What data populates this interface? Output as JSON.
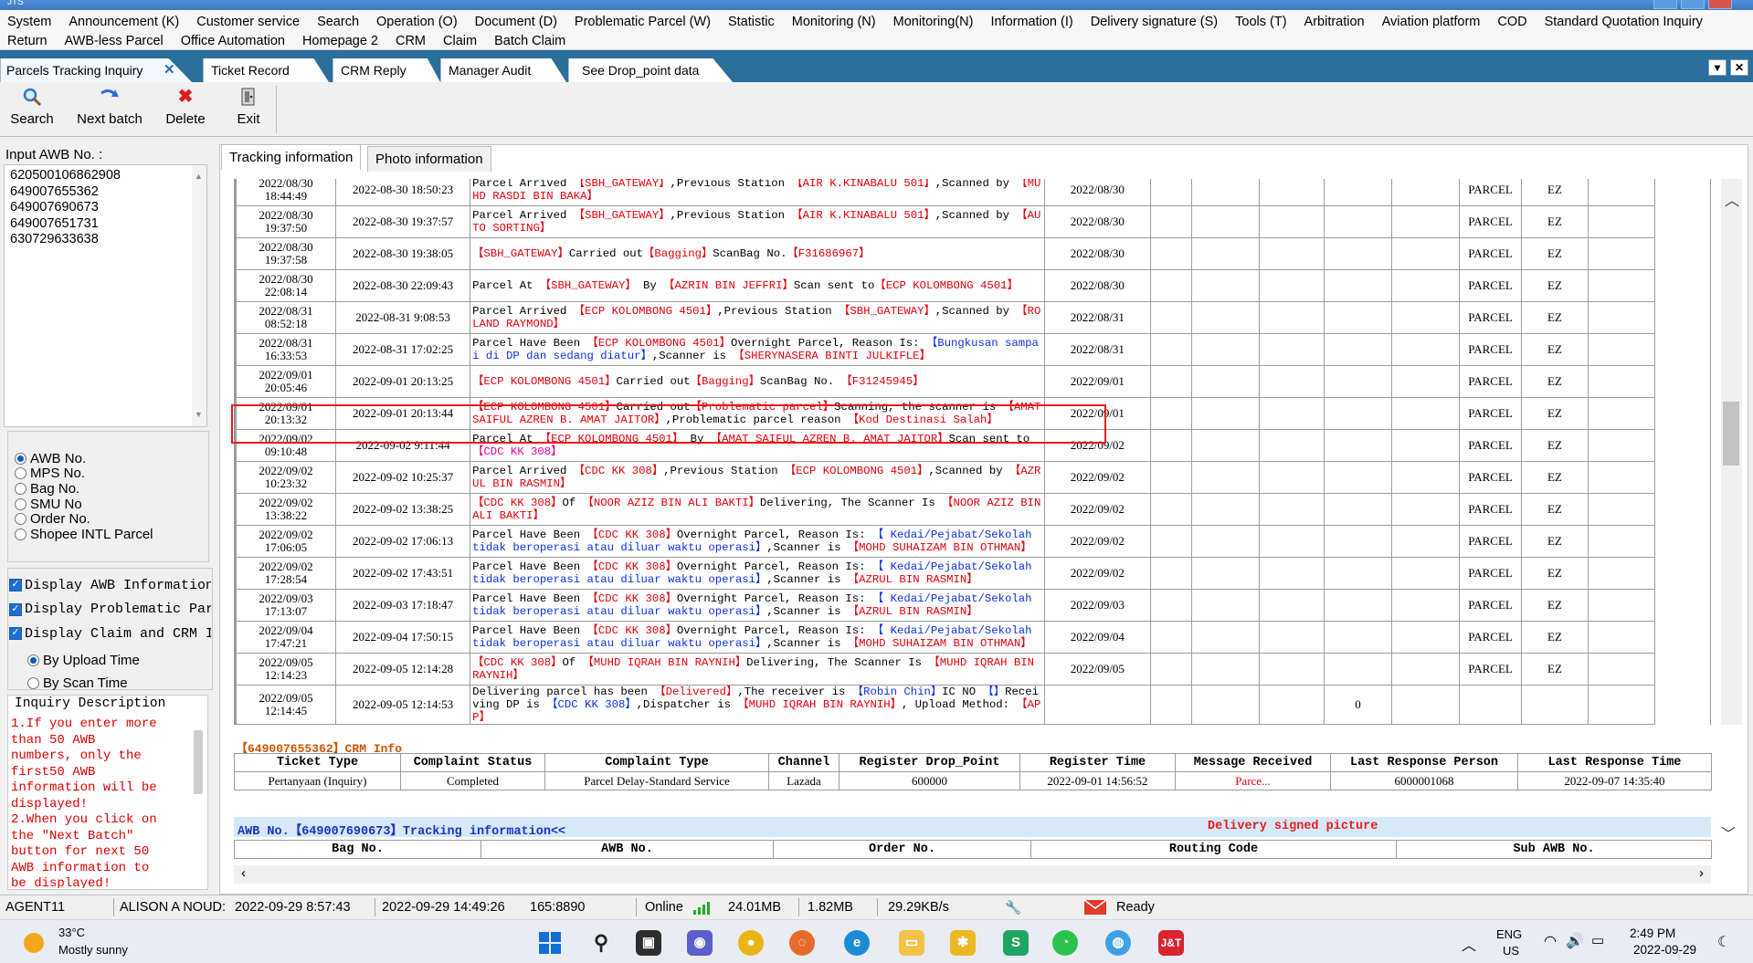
{
  "window": {
    "title": "JTS"
  },
  "menu": {
    "row1": [
      "System",
      "Announcement (K)",
      "Customer service",
      "Search",
      "Operation (O)",
      "Document (D)",
      "Problematic Parcel (W)",
      "Statistic",
      "Monitoring (N)",
      "Monitoring(N)",
      "Information (I)",
      "Delivery signature (S)",
      "Tools (T)",
      "Arbitration",
      "Aviation platform",
      "COD",
      "Standard Quotation Inquiry"
    ],
    "row2": [
      "Return",
      "AWB-less Parcel",
      "Office Automation",
      "Homepage 2",
      "CRM",
      "Claim",
      "Batch Claim"
    ]
  },
  "doc_tabs": [
    "Parcels Tracking Inquiry",
    "Ticket Record",
    "CRM Reply",
    "Manager Audit",
    "See Drop_point data"
  ],
  "toolbar": {
    "search": "Search",
    "next_batch": "Next batch",
    "delete": "Delete",
    "exit": "Exit"
  },
  "left": {
    "input_label": "Input AWB No. :",
    "awbs": [
      "620500106862908",
      "649007655362",
      "649007690673",
      "649007651731",
      "630729633638"
    ],
    "radio_options": [
      "AWB No.",
      "MPS No.",
      "Bag No.",
      "SMU No",
      "Order No.",
      "Shopee INTL Parcel"
    ],
    "checkboxes": [
      "Display AWB Information",
      "Display Problematic Par",
      "Display Claim and CRM I"
    ],
    "time_options": [
      "By Upload Time",
      "By Scan Time"
    ],
    "inquiry_title": "Inquiry Description",
    "inquiry_text": "1.If you enter more than 50 AWB numbers, only the first50 AWB information will be displayed!\n2.When you click on the \"Next Batch\" button for next 50 AWB information to be displayed!"
  },
  "content_tabs": [
    "Tracking information",
    "Photo information"
  ],
  "tracking_rows": [
    {
      "upload": "2022/08/30 18:44:49",
      "scan": "2022-08-30 18:50:23",
      "desc": [
        [
          "k",
          "Parcel Arrived "
        ],
        [
          "r",
          "【SBH_GATEWAY】"
        ],
        [
          "k",
          ",Previous Station "
        ],
        [
          "r",
          "【AIR K.KINABALU 501】"
        ],
        [
          "k",
          ",Scanned by "
        ],
        [
          "r",
          "【MUHD RASDI BIN BAKA】"
        ]
      ],
      "date": "2022/08/30",
      "extra": "",
      "type": "PARCEL",
      "code": "EZ"
    },
    {
      "upload": "2022/08/30 19:37:50",
      "scan": "2022-08-30 19:37:57",
      "desc": [
        [
          "k",
          "Parcel Arrived "
        ],
        [
          "r",
          "【SBH_GATEWAY】"
        ],
        [
          "k",
          ",Previous Station "
        ],
        [
          "r",
          "【AIR K.KINABALU 501】"
        ],
        [
          "k",
          ",Scanned by "
        ],
        [
          "r",
          "【AUTO SORTING】"
        ]
      ],
      "date": "2022/08/30",
      "extra": "",
      "type": "PARCEL",
      "code": "EZ"
    },
    {
      "upload": "2022/08/30 19:37:58",
      "scan": "2022-08-30 19:38:05",
      "desc": [
        [
          "r",
          "【SBH_GATEWAY】"
        ],
        [
          "k",
          "Carried out"
        ],
        [
          "r",
          "【Bagging】"
        ],
        [
          "k",
          "ScanBag No."
        ],
        [
          "r",
          "【F31686967】"
        ]
      ],
      "date": "2022/08/30",
      "extra": "",
      "type": "PARCEL",
      "code": "EZ"
    },
    {
      "upload": "2022/08/30 22:08:14",
      "scan": "2022-08-30 22:09:43",
      "desc": [
        [
          "k",
          "Parcel At "
        ],
        [
          "r",
          "【SBH_GATEWAY】"
        ],
        [
          "k",
          " By "
        ],
        [
          "r",
          "【AZRIN BIN JEFFRI】"
        ],
        [
          "k",
          "Scan sent to"
        ],
        [
          "r",
          "【ECP KOLOMBONG 4501】"
        ]
      ],
      "date": "2022/08/30",
      "extra": "",
      "type": "PARCEL",
      "code": "EZ"
    },
    {
      "upload": "2022/08/31 08:52:18",
      "scan": "2022-08-31 9:08:53",
      "desc": [
        [
          "k",
          "Parcel Arrived "
        ],
        [
          "r",
          "【ECP KOLOMBONG 4501】"
        ],
        [
          "k",
          ",Previous Station "
        ],
        [
          "r",
          "【SBH_GATEWAY】"
        ],
        [
          "k",
          ",Scanned by "
        ],
        [
          "r",
          "【ROLAND RAYMOND】"
        ]
      ],
      "date": "2022/08/31",
      "extra": "",
      "type": "PARCEL",
      "code": "EZ"
    },
    {
      "upload": "2022/08/31 16:33:53",
      "scan": "2022-08-31 17:02:25",
      "desc": [
        [
          "k",
          "Parcel Have Been "
        ],
        [
          "r",
          "【ECP KOLOMBONG 4501】"
        ],
        [
          "k",
          "Overnight Parcel, Reason Is: "
        ],
        [
          "b",
          "【Bungkusan sampai di DP dan sedang diatur】"
        ],
        [
          "k",
          ",Scanner is "
        ],
        [
          "r",
          "【SHERYNASERA BINTI JULKIFLE】"
        ]
      ],
      "date": "2022/08/31",
      "extra": "",
      "type": "PARCEL",
      "code": "EZ"
    },
    {
      "upload": "2022/09/01 20:05:46",
      "scan": "2022-09-01 20:13:25",
      "desc": [
        [
          "r",
          "【ECP KOLOMBONG 4501】"
        ],
        [
          "k",
          "Carried out"
        ],
        [
          "r",
          "【Bagging】"
        ],
        [
          "k",
          "ScanBag No. "
        ],
        [
          "r",
          "【F31245945】"
        ]
      ],
      "date": "2022/09/01",
      "extra": "",
      "type": "PARCEL",
      "code": "EZ"
    },
    {
      "upload": "2022/09/01 20:13:32",
      "scan": "2022-09-01 20:13:44",
      "desc": [
        [
          "r",
          "【ECP KOLOMBONG 4501】"
        ],
        [
          "k",
          "Carried out"
        ],
        [
          "r",
          "【Problematic parcel】"
        ],
        [
          "k",
          "Scanning, the scanner is "
        ],
        [
          "r",
          "【AMAT SAIFUL AZREN B. AMAT JAITOR】"
        ],
        [
          "k",
          ",Problematic parcel reason "
        ],
        [
          "r",
          "【Kod Destinasi Salah】"
        ]
      ],
      "date": "2022/09/01",
      "extra": "",
      "type": "PARCEL",
      "code": "EZ"
    },
    {
      "upload": "2022/09/02 09:10:48",
      "scan": "2022-09-02 9:11:44",
      "desc": [
        [
          "k",
          "Parcel At "
        ],
        [
          "r",
          "【ECP KOLOMBONG 4501】"
        ],
        [
          "k",
          " By "
        ],
        [
          "r",
          "【AMAT SAIFUL AZREN B. AMAT JAITOR】"
        ],
        [
          "k",
          "Scan sent to"
        ],
        [
          "m",
          "【CDC KK 308】"
        ]
      ],
      "date": "2022/09/02",
      "extra": "",
      "type": "PARCEL",
      "code": "EZ"
    },
    {
      "upload": "2022/09/02 10:23:32",
      "scan": "2022-09-02 10:25:37",
      "desc": [
        [
          "k",
          "Parcel Arrived "
        ],
        [
          "r",
          "【CDC KK 308】"
        ],
        [
          "k",
          ",Previous Station "
        ],
        [
          "r",
          "【ECP KOLOMBONG 4501】"
        ],
        [
          "k",
          ",Scanned by "
        ],
        [
          "r",
          "【AZRUL BIN RASMIN】"
        ]
      ],
      "date": "2022/09/02",
      "extra": "",
      "type": "PARCEL",
      "code": "EZ"
    },
    {
      "upload": "2022/09/02 13:38:22",
      "scan": "2022-09-02 13:38:25",
      "desc": [
        [
          "r",
          "【CDC KK 308】"
        ],
        [
          "k",
          "Of "
        ],
        [
          "r",
          "【NOOR AZIZ BIN ALI BAKTI】"
        ],
        [
          "k",
          "Delivering, The Scanner Is "
        ],
        [
          "r",
          "【NOOR AZIZ BIN ALI BAKTI】"
        ]
      ],
      "date": "2022/09/02",
      "extra": "",
      "type": "PARCEL",
      "code": "EZ"
    },
    {
      "upload": "2022/09/02 17:06:05",
      "scan": "2022-09-02 17:06:13",
      "desc": [
        [
          "k",
          "Parcel Have Been "
        ],
        [
          "r",
          "【CDC KK 308】"
        ],
        [
          "k",
          "Overnight Parcel, Reason Is: "
        ],
        [
          "b",
          "【 Kedai/Pejabat/Sekolah tidak beroperasi atau diluar waktu operasi】"
        ],
        [
          "k",
          ",Scanner is "
        ],
        [
          "r",
          "【MOHD SUHAIZAM BIN OTHMAN】"
        ]
      ],
      "date": "2022/09/02",
      "extra": "",
      "type": "PARCEL",
      "code": "EZ"
    },
    {
      "upload": "2022/09/02 17:28:54",
      "scan": "2022-09-02 17:43:51",
      "desc": [
        [
          "k",
          "Parcel Have Been "
        ],
        [
          "r",
          "【CDC KK 308】"
        ],
        [
          "k",
          "Overnight Parcel, Reason Is: "
        ],
        [
          "b",
          "【 Kedai/Pejabat/Sekolah tidak beroperasi atau diluar waktu operasi】"
        ],
        [
          "k",
          ",Scanner is "
        ],
        [
          "r",
          "【AZRUL BIN RASMIN】"
        ]
      ],
      "date": "2022/09/02",
      "extra": "",
      "type": "PARCEL",
      "code": "EZ"
    },
    {
      "upload": "2022/09/03 17:13:07",
      "scan": "2022-09-03 17:18:47",
      "desc": [
        [
          "k",
          "Parcel Have Been "
        ],
        [
          "r",
          "【CDC KK 308】"
        ],
        [
          "k",
          "Overnight Parcel, Reason Is: "
        ],
        [
          "b",
          "【 Kedai/Pejabat/Sekolah tidak beroperasi atau diluar waktu operasi】"
        ],
        [
          "k",
          ",Scanner is "
        ],
        [
          "r",
          "【AZRUL BIN RASMIN】"
        ]
      ],
      "date": "2022/09/03",
      "extra": "",
      "type": "PARCEL",
      "code": "EZ"
    },
    {
      "upload": "2022/09/04 17:47:21",
      "scan": "2022-09-04 17:50:15",
      "desc": [
        [
          "k",
          "Parcel Have Been "
        ],
        [
          "r",
          "【CDC KK 308】"
        ],
        [
          "k",
          "Overnight Parcel, Reason Is: "
        ],
        [
          "b",
          "【 Kedai/Pejabat/Sekolah tidak beroperasi atau diluar waktu operasi】"
        ],
        [
          "k",
          ",Scanner is "
        ],
        [
          "r",
          "【MOHD SUHAIZAM BIN OTHMAN】"
        ]
      ],
      "date": "2022/09/04",
      "extra": "",
      "type": "PARCEL",
      "code": "EZ"
    },
    {
      "upload": "2022/09/05 12:14:23",
      "scan": "2022-09-05 12:14:28",
      "desc": [
        [
          "r",
          "【CDC KK 308】"
        ],
        [
          "k",
          "Of "
        ],
        [
          "r",
          "【MUHD IQRAH BIN RAYNIH】"
        ],
        [
          "k",
          "Delivering, The Scanner Is "
        ],
        [
          "r",
          "【MUHD IQRAH BIN RAYNIH】"
        ]
      ],
      "date": "2022/09/05",
      "extra": "",
      "type": "PARCEL",
      "code": "EZ"
    },
    {
      "upload": "2022/09/05 12:14:45",
      "scan": "2022-09-05 12:14:53",
      "desc": [
        [
          "k",
          "Delivering parcel has been "
        ],
        [
          "r",
          "【Delivered】"
        ],
        [
          "k",
          ",The receiver is "
        ],
        [
          "b",
          "【Robin Chin】"
        ],
        [
          "k",
          "IC NO "
        ],
        [
          "b",
          "【】"
        ],
        [
          "k",
          "Receiving DP is "
        ],
        [
          "b",
          "【CDC KK 308】"
        ],
        [
          "k",
          ",Dispatcher is "
        ],
        [
          "r",
          "【MUHD IQRAH BIN RAYNIH】"
        ],
        [
          "k",
          ", Upload Method: "
        ],
        [
          "r",
          "【APP】"
        ]
      ],
      "date": "",
      "extra": "0",
      "type": "",
      "code": ""
    }
  ],
  "crm": {
    "title": "【649007655362】CRM Info",
    "headers": [
      "Ticket Type",
      "Complaint Status",
      "Complaint Type",
      "Channel",
      "Register Drop_Point",
      "Register Time",
      "Message Received",
      "Last Response Person",
      "Last Response Time"
    ],
    "row": [
      "Pertanyaan (Inquiry)",
      "Completed",
      "Parcel Delay-Standard Service",
      "Lazada",
      "600000",
      "2022-09-01 14:56:52",
      "Parce...",
      "6000001068",
      "2022-09-07 14:35:40"
    ]
  },
  "tracking_bar": {
    "title": "AWB No.【649007690673】Tracking information<<",
    "delivery": "Delivery signed picture"
  },
  "bottom_headers": [
    "Bag No.",
    "AWB No.",
    "Order No.",
    "Routing Code",
    "Sub AWB No."
  ],
  "status": {
    "user": "AGENT11",
    "name": "ALISON A NOUD:",
    "login": "2022-09-29 8:57:43",
    "now": "2022-09-29 14:49:26",
    "port": "165:8890",
    "online": "Online",
    "mem1": "24.01MB",
    "mem2": "1.82MB",
    "speed": "29.29KB/s",
    "ready": "Ready"
  },
  "taskbar": {
    "temp": "33°C",
    "weather": "Mostly sunny",
    "lang1": "ENG",
    "lang2": "US",
    "time": "2:49 PM",
    "date": "2022-09-29"
  },
  "colors": {
    "red": "#e8000a",
    "blue": "#0b30e8",
    "magenta": "#ee009a",
    "tab_bg": "#2a6f9b",
    "highlight": "#e61c1c"
  }
}
